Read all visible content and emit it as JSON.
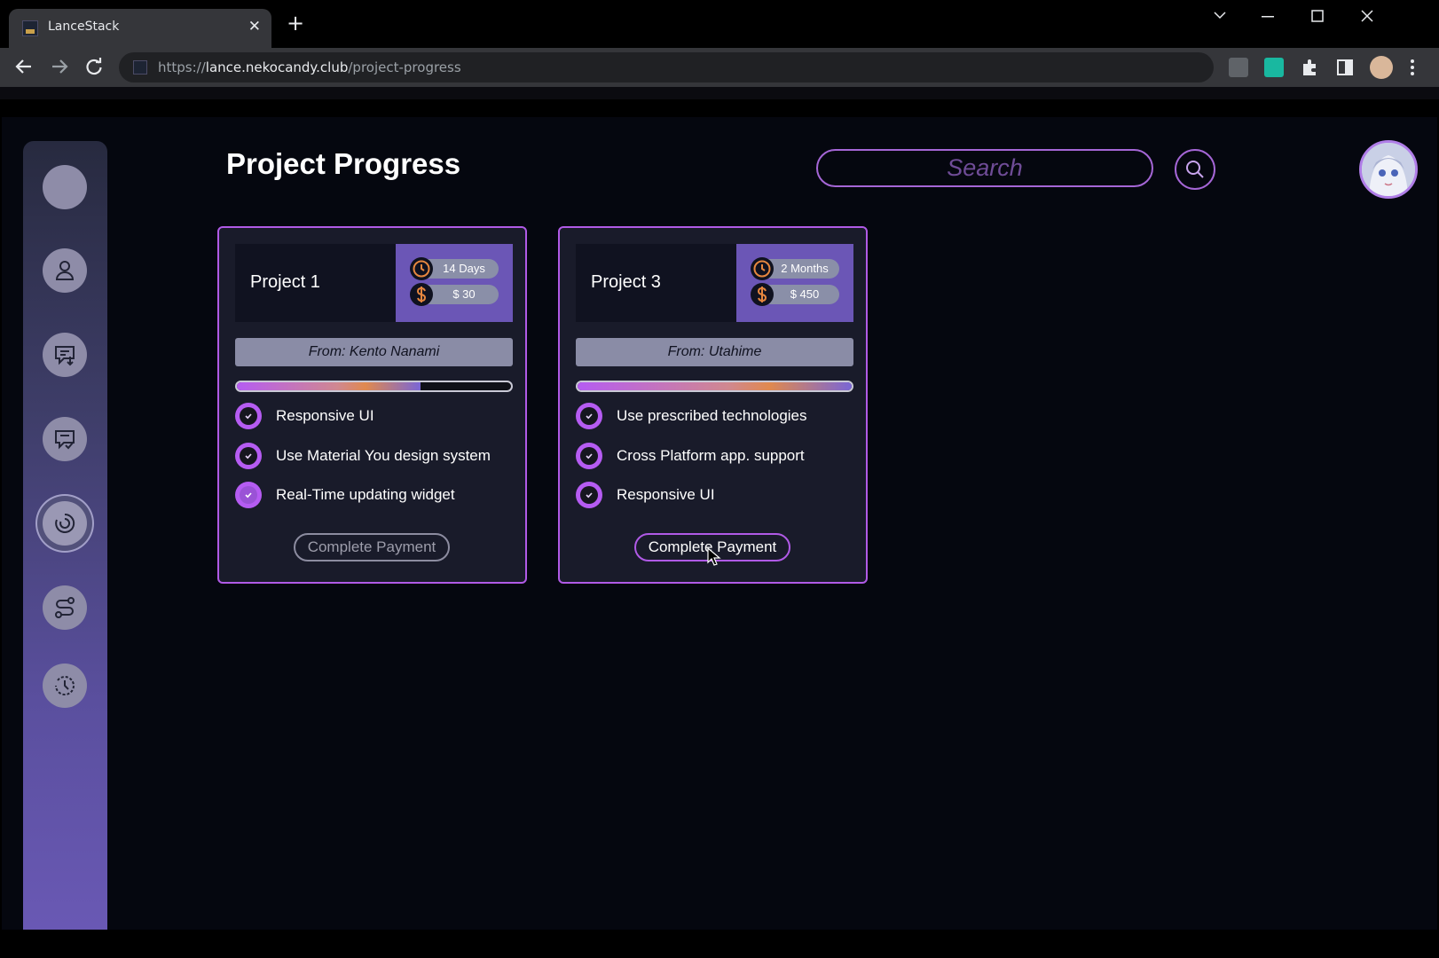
{
  "browser": {
    "tab_title": "LanceStack",
    "url_scheme": "https://",
    "url_host": "lance.nekocandy.club",
    "url_path": "/project-progress",
    "new_tab_glyph": "+",
    "close_glyph": "✕"
  },
  "header": {
    "title": "Project Progress",
    "search_placeholder": "Search"
  },
  "sidebar": {
    "items": [
      {
        "icon": "circle-icon"
      },
      {
        "icon": "user-icon"
      },
      {
        "icon": "message-download-icon"
      },
      {
        "icon": "message-check-icon"
      },
      {
        "icon": "progress-icon",
        "active": true
      },
      {
        "icon": "route-icon"
      },
      {
        "icon": "history-icon"
      }
    ]
  },
  "projects": [
    {
      "name": "Project 1",
      "duration": "14 Days",
      "price": "$ 30",
      "from": "From: Kento Nanami",
      "progress": 0.67,
      "tasks": [
        {
          "label": "Responsive UI",
          "done": false
        },
        {
          "label": "Use Material You design system",
          "done": false
        },
        {
          "label": "Real-Time updating widget",
          "done": true
        }
      ],
      "button": "Complete Payment",
      "button_enabled": false
    },
    {
      "name": "Project 3",
      "duration": "2 Months",
      "price": "$ 450",
      "from": "From: Utahime",
      "progress": 1.0,
      "tasks": [
        {
          "label": "Use prescribed technologies",
          "done": false
        },
        {
          "label": "Cross Platform app. support",
          "done": false
        },
        {
          "label": "Responsive UI",
          "done": false
        }
      ],
      "button": "Complete Payment",
      "button_enabled": true
    }
  ],
  "colors": {
    "accent": "#b05ae6",
    "card_bg": "#191b2a",
    "meta_bg": "#6b56b6",
    "page_bg": "#05070f"
  }
}
